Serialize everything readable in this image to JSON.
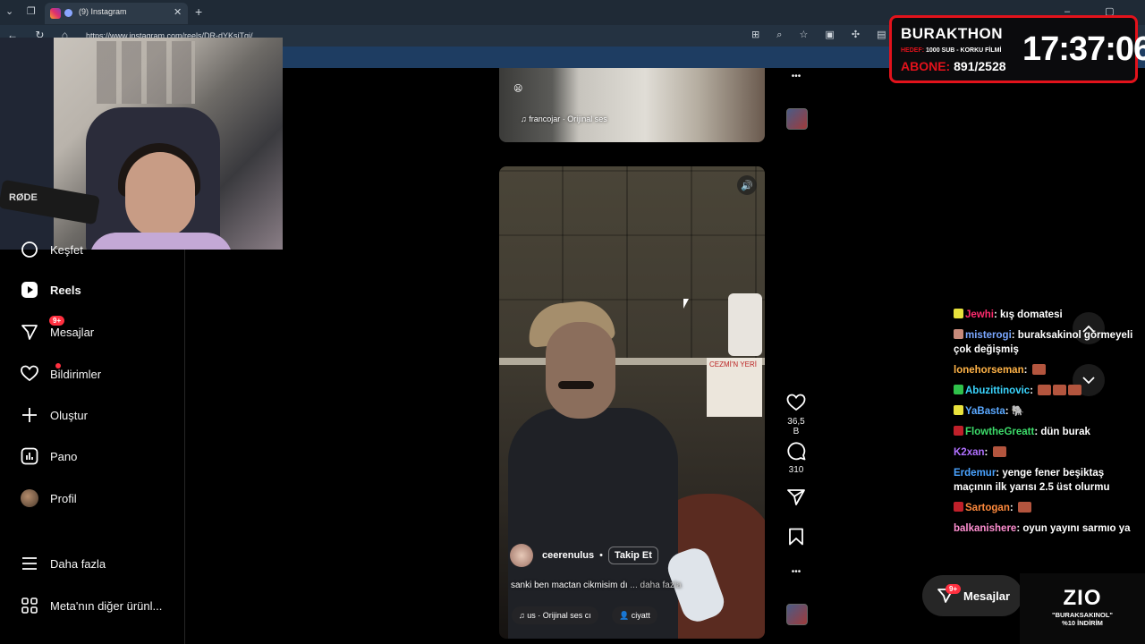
{
  "browser": {
    "tab_title": "(9) Instagram",
    "url": "https://www.instagram.com/reels/DR-dYKsiTqi/",
    "new_tab": "+",
    "tab_close": "✕",
    "window_controls": "–  ▢  ✕"
  },
  "webcam": {
    "mic_brand": "RØDE"
  },
  "sidebar": {
    "partial_item": "Keşfet",
    "items": [
      {
        "label": "Reels",
        "icon": "reels-icon",
        "active": true
      },
      {
        "label": "Mesajlar",
        "icon": "messages-icon",
        "badge": "9+"
      },
      {
        "label": "Bildirimler",
        "icon": "heart-icon"
      },
      {
        "label": "Oluştur",
        "icon": "plus-icon"
      },
      {
        "label": "Pano",
        "icon": "dashboard-icon"
      },
      {
        "label": "Profil",
        "icon": "avatar"
      },
      {
        "label": "Daha fazla",
        "icon": "menu-icon"
      },
      {
        "label": "Meta'nın diğer ürünl...",
        "icon": "grid-icon"
      }
    ]
  },
  "prev_reel": {
    "audio": "francojar · Orijinal ses"
  },
  "reel": {
    "author": "ceerenulus",
    "follow": "Takip Et",
    "caption": "sanki ben mactan cikmisim dı",
    "more": "... daha fazla",
    "audio": "us · Orijinal ses  cı",
    "tagged": "ciyatt",
    "sign_text": "CEZMİ'N YERİ",
    "likes": "36,5 B",
    "comments": "310"
  },
  "overlay": {
    "title": "BURAKTHON",
    "goal_label": "HEDEF:",
    "goal_text": "1000 SUB - KORKU FİLMİ",
    "subs_label": "ABONE:",
    "subs_value": "891/2528",
    "clock": "17:37:06"
  },
  "chat": [
    {
      "user": "Jewhi",
      "color": "#ff2b6e",
      "text": "kış domatesi",
      "badge": "#e8e23c"
    },
    {
      "user": "misterogi",
      "color": "#7aa7ff",
      "text": "buraksakinol görmeyeli çok değişmiş",
      "badge": "#c78a7a"
    },
    {
      "user": "lonehorseman",
      "color": "#ffb347",
      "text": "",
      "emotes": 1
    },
    {
      "user": "Abuzittinovic",
      "color": "#3ad6ff",
      "text": "",
      "badge": "#2fc14a",
      "emotes": 3
    },
    {
      "user": "YaBasta",
      "color": "#5aa8ff",
      "text": "🐘",
      "badge": "#e8e23c"
    },
    {
      "user": "FlowtheGreatt",
      "color": "#3ddc6a",
      "text": "dün burak",
      "badge": "#c0202a"
    },
    {
      "user": "K2xan",
      "color": "#b070ff",
      "text": "",
      "emotes": 1
    },
    {
      "user": "Erdemur",
      "color": "#4aa3ff",
      "text": "yenge fener beşiktaş maçının ilk yarısı 2.5 üst olurmu"
    },
    {
      "user": "Sartogan",
      "color": "#ff8a3d",
      "text": "",
      "badge": "#c0202a",
      "emotes": 1
    },
    {
      "user": "balkanishere",
      "color": "#ff8fd1",
      "text": "oyun yayını sarmıo ya"
    }
  ],
  "dm_button": {
    "label": "Mesajlar",
    "badge": "9+"
  },
  "sponsor": {
    "brand": "ZIO",
    "line1": "\"BURAKSAKINOL\"",
    "line2": "%10 İNDİRİM"
  }
}
